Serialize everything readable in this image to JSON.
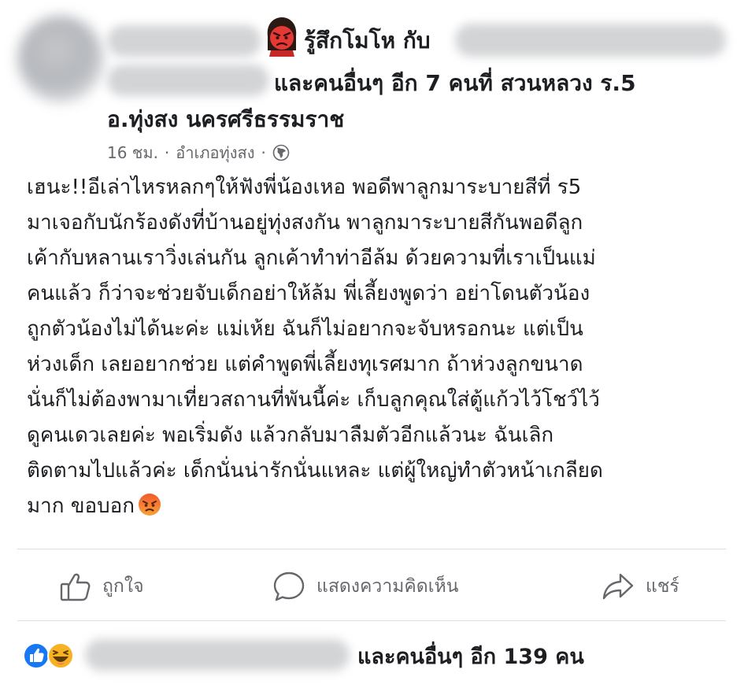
{
  "post": {
    "feeling": "รู้สึกโมโห กับ",
    "tag_suffix": "และคนอื่นๆ อีก 7 คนที่ สวนหลวง ร.5",
    "location_line2": "อ.ทุ่งสง นครศรีธรรมราช",
    "time": "16 ชม.",
    "place": "อำเภอทุ่งสง",
    "separator": "·",
    "body_lines": [
      "เฮนะ!!อีเล่าไหรหลกๆให้ฟังพี่น้องเหอ พอดีพาลูกมาระบายสีที่ ร5",
      "มาเจอกับนักร้องดังที่บ้านอยู่ทุ่งสงกัน พาลูกมาระบายสีกันพอดีลูก",
      "เค้ากับหลานเราวิ่งเล่นกัน ลูกเค้าทำท่าอีล้ม ด้วยความที่เราเป็นแม่",
      "คนแล้ว ก็ว่าจะช่วยจับเด็กอย่าให้ล้ม พี่เลี้ยงพูดว่า อย่าโดนตัวน้อง",
      "ถูกตัวน้องไม่ได้นะค่ะ แม่เห้ย ฉันก็ไม่อยากจะจับหรอกนะ แต่เป็น",
      "ห่วงเด็ก เลยอยากช่วย แต่คำพูดพี่เลี้ยงทุเรศมาก ถ้าห่วงลูกขนาด",
      "นั่นก็ไม่ต้องพามาเที่ยวสถานที่พันนี้ค่ะ เก็บลูกคุณใส่ตู้แก้วไว้โชว์ไว้",
      "ดูคนเดวเลยค่ะ  พอเริ่มดัง แล้วกลับมาลืมตัวอีกแล้วนะ ฉันเลิก",
      "ติดตามไปแล้วค่ะ เด็กนั่นน่ารักนั่นแหละ แต่ผู้ใหญ่ทำตัวหน้าเกลียด",
      "มาก ขอบอก"
    ]
  },
  "actions": {
    "like": "ถูกใจ",
    "comment": "แสดงความคิดเห็น",
    "share": "แชร์"
  },
  "reactions": {
    "summary": "และคนอื่นๆ อีก 139 คน"
  },
  "colors": {
    "text": "#1c1e21",
    "secondary": "#65676b",
    "like_blue": "#1877f2",
    "haha_yellow": "#f7b125",
    "angry_red": "#e9710f"
  }
}
